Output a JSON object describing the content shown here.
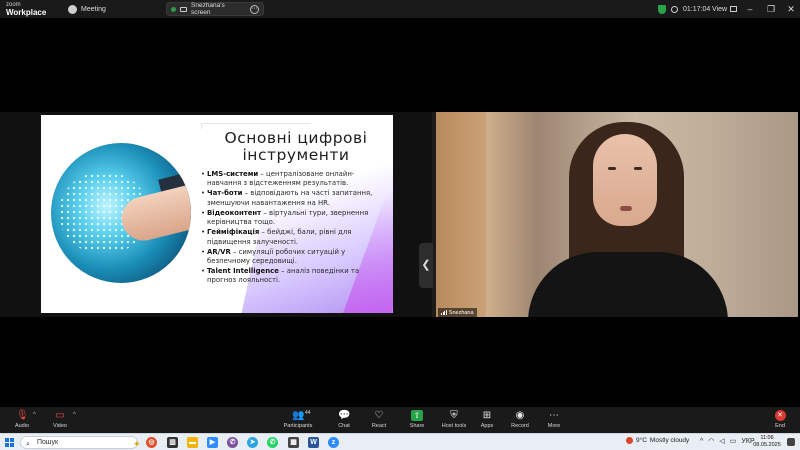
{
  "app": {
    "brand_line1": "zoom",
    "brand_line2": "Workplace",
    "meeting_label": "Meeting"
  },
  "share": {
    "label": "Snezhana's screen"
  },
  "topbar": {
    "timer": "01:17:04",
    "view_label": "View"
  },
  "window_controls": {
    "minimize": "–",
    "restore": "❐",
    "close": "✕"
  },
  "slide": {
    "title": "Основні цифрові інструменти",
    "bullets": [
      {
        "term": "LMS-системи",
        "text": " – централізоване онлайн-навчання з відстеженням результатів."
      },
      {
        "term": "Чат-боти",
        "text": " – відповідають на часті запитання, зменшуючи навантаження на HR."
      },
      {
        "term": "Відеоконтент",
        "text": " – віртуальні тури, звернення керівництва тощо."
      },
      {
        "term": "Гейміфікація",
        "text": " – бейджі, бали, рівні для підвищення залученості."
      },
      {
        "term": "AR/VR",
        "text": " – симуляції робочих ситуацій у безпечному середовищі."
      },
      {
        "term": "Talent Intelligence",
        "text": " – аналіз поведінки та прогноз лояльності."
      }
    ]
  },
  "collapse_button": "❮",
  "participant": {
    "name": "Snezhana"
  },
  "controls": {
    "audio": "Audio",
    "video": "Video",
    "participants": "Participants",
    "participants_count": "44",
    "chat": "Chat",
    "react": "React",
    "share": "Share",
    "host_tools": "Host tools",
    "apps": "Apps",
    "record": "Record",
    "more": "More",
    "end": "End"
  },
  "taskbar": {
    "search_placeholder": "Пошук",
    "weather_temp": "9°C",
    "weather_text": "Mostly cloudy",
    "language": "УКР",
    "time": "11:06",
    "date": "08.05.2025"
  },
  "colors": {
    "accent_green": "#27a34a",
    "end_red": "#d93a33",
    "win_blue": "#1a73d9"
  }
}
